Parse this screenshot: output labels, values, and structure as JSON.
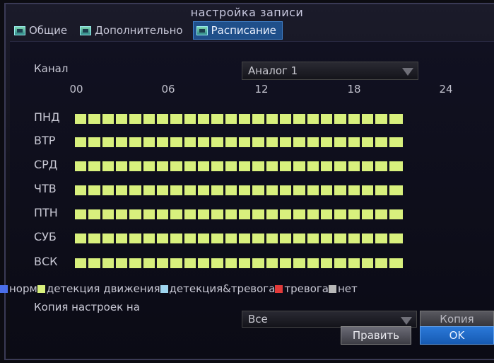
{
  "window": {
    "title": "настройка записи"
  },
  "tabs": [
    {
      "label": "Общие",
      "active": false
    },
    {
      "label": "Дополнительно",
      "active": false
    },
    {
      "label": "Расписание",
      "active": true
    }
  ],
  "channel": {
    "label": "Канал",
    "value": "Аналог 1"
  },
  "hours": [
    "00",
    "06",
    "12",
    "18",
    "24"
  ],
  "days": [
    "ПНД",
    "ВТР",
    "СРД",
    "ЧТВ",
    "ПТН",
    "СУБ",
    "ВСК"
  ],
  "schedule": {
    "segments_per_day": 24,
    "cell_color": "#d8f07d",
    "state": "detection-motion"
  },
  "legend": [
    {
      "label": "норм",
      "color": "#4a6ee8"
    },
    {
      "label": "детекция движения",
      "color": "#d8f07d"
    },
    {
      "label": "детекция&тревога",
      "color": "#9fd6f0"
    },
    {
      "label": "тревога",
      "color": "#e23a3a"
    },
    {
      "label": "нет",
      "color": "#b8b8b8"
    }
  ],
  "copy": {
    "label": "Копия настроек на",
    "value": "Все",
    "button": "Копия"
  },
  "buttons": {
    "edit": "Править",
    "ok": "OK"
  }
}
